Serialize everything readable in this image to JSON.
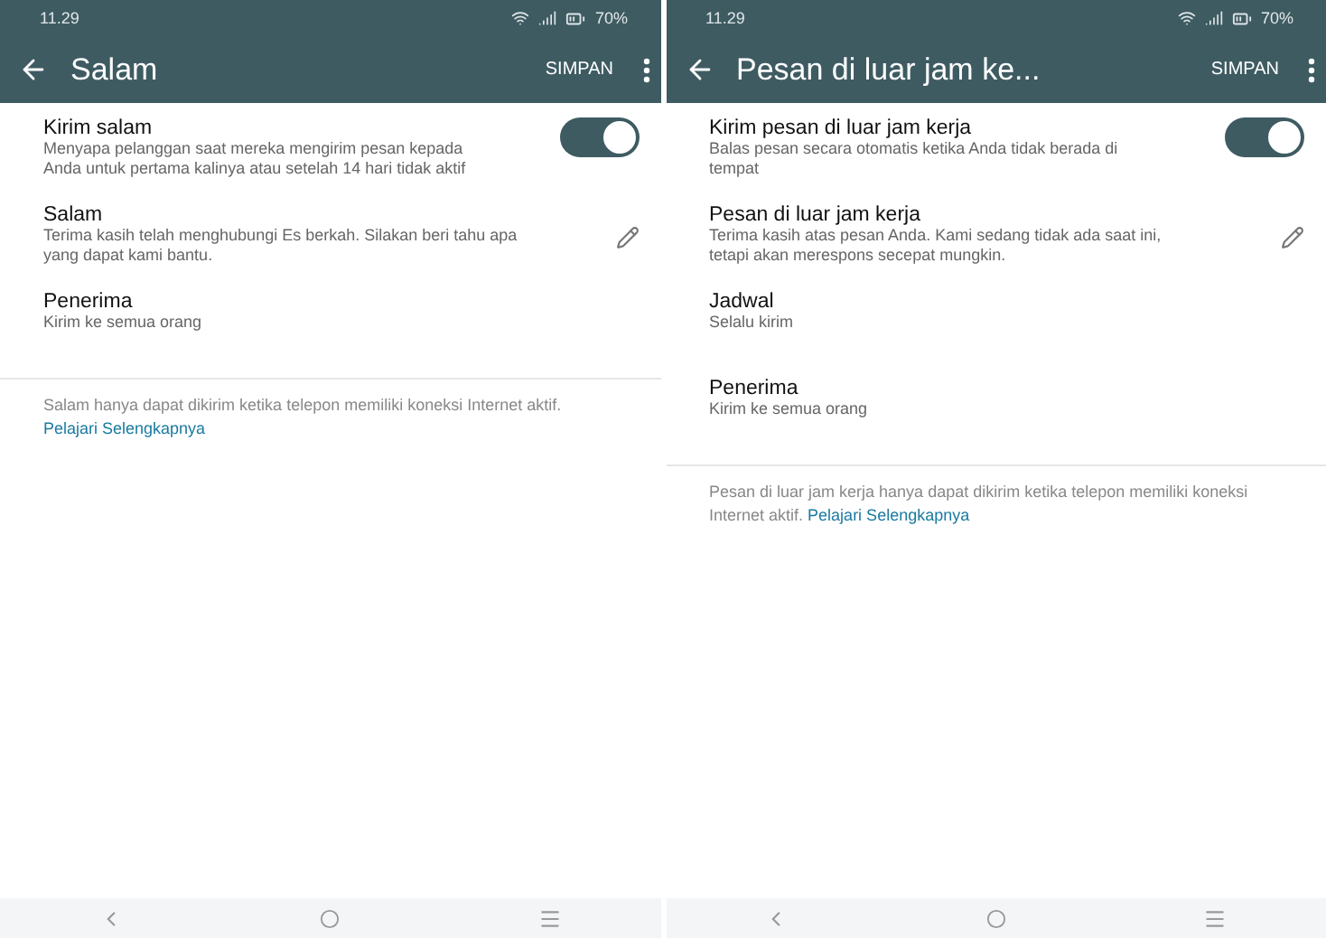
{
  "screens": [
    {
      "status": {
        "time": "11.29",
        "battery": "70%"
      },
      "title": "Salam",
      "save": "SIMPAN",
      "items": [
        {
          "kind": "toggle",
          "title": "Kirim salam",
          "subtitle": "Menyapa pelanggan saat mereka mengirim pesan kepada Anda untuk pertama kalinya atau setelah 14 hari tidak aktif",
          "on": true
        },
        {
          "kind": "edit",
          "title": "Salam",
          "subtitle": "Terima kasih telah menghubungi Es berkah. Silakan beri tahu apa yang dapat kami bantu."
        },
        {
          "kind": "plain",
          "title": "Penerima",
          "subtitle": "Kirim ke semua orang"
        }
      ],
      "footer": {
        "text": "Salam hanya dapat dikirim ketika telepon memiliki koneksi Internet aktif.",
        "link": "Pelajari Selengkapnya"
      }
    },
    {
      "status": {
        "time": "11.29",
        "battery": "70%"
      },
      "title": "Pesan di luar jam ke...",
      "save": "SIMPAN",
      "items": [
        {
          "kind": "toggle",
          "title": "Kirim pesan di luar jam kerja",
          "subtitle": "Balas pesan secara otomatis ketika Anda tidak berada di tempat",
          "on": true
        },
        {
          "kind": "edit",
          "title": "Pesan di luar jam kerja",
          "subtitle": "Terima kasih atas pesan Anda. Kami sedang tidak ada saat ini, tetapi akan merespons secepat mungkin."
        },
        {
          "kind": "plain",
          "title": "Jadwal",
          "subtitle": "Selalu kirim"
        },
        {
          "kind": "plain",
          "title": "Penerima",
          "subtitle": "Kirim ke semua orang"
        }
      ],
      "footer": {
        "text": "Pesan di luar jam kerja hanya dapat dikirim ketika telepon memiliki koneksi Internet aktif.",
        "link": "Pelajari Selengkapnya"
      }
    }
  ]
}
